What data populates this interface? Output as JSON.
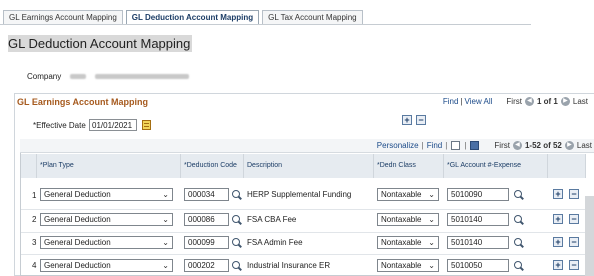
{
  "tabs": [
    {
      "label": "GL Earnings Account Mapping",
      "active": false
    },
    {
      "label": "GL Deduction Account Mapping",
      "active": true
    },
    {
      "label": "GL Tax Account Mapping",
      "active": false
    }
  ],
  "page_title": "GL Deduction Account Mapping",
  "company": {
    "label": "Company"
  },
  "section": {
    "title": "GL Earnings Account Mapping",
    "find": "Find",
    "separator": "|",
    "view_all": "View All",
    "first": "First",
    "range": "1 of 1",
    "last": "Last",
    "prev_arrow": "◀",
    "next_arrow": "▶"
  },
  "effective_date": {
    "label": "*Effective Date",
    "value": "01/01/2021"
  },
  "grid_nav": {
    "personalize": "Personalize",
    "find": "Find",
    "first": "First",
    "range": "1-52 of 52",
    "last": "Last"
  },
  "columns": {
    "plan_type": "*Plan Type",
    "deduction_code": "*Deduction Code",
    "description": "Description",
    "dedn_class": "*Dedn Class",
    "gl_account": "*GL Account #-Expense"
  },
  "rows": [
    {
      "num": "1",
      "plan_type": "General Deduction",
      "deduction_code": "000034",
      "description": "HERP Supplemental Funding",
      "dedn_class": "Nontaxable",
      "gl_account": "5010090"
    },
    {
      "num": "2",
      "plan_type": "General Deduction",
      "deduction_code": "000086",
      "description": "FSA CBA Fee",
      "dedn_class": "Nontaxable",
      "gl_account": "5010140"
    },
    {
      "num": "3",
      "plan_type": "General Deduction",
      "deduction_code": "000099",
      "description": "FSA Admin Fee",
      "dedn_class": "Nontaxable",
      "gl_account": "5010140"
    },
    {
      "num": "4",
      "plan_type": "General Deduction",
      "deduction_code": "000202",
      "description": "Industrial Insurance ER",
      "dedn_class": "Nontaxable",
      "gl_account": "5010050"
    }
  ],
  "icons": {
    "add": "+",
    "remove": "−",
    "chevron": "⌄"
  }
}
